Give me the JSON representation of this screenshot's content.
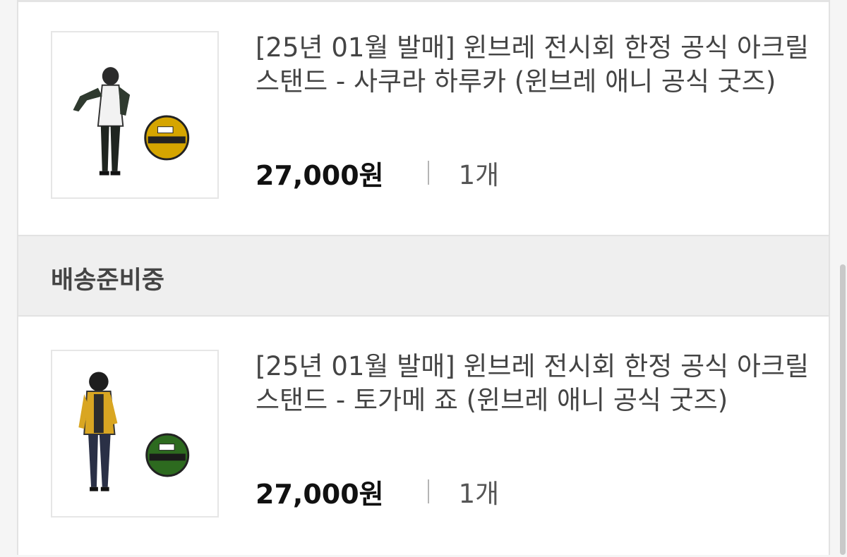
{
  "items": [
    {
      "title": "[25년 01월 발매] 윈브레 전시회 한정 공식 아크릴 스탠드 - 사쿠라 하루카 (윈브레 애니 공식 굿즈)",
      "price": "27,000원",
      "quantity": "1개",
      "badge_color": "#d5a500"
    },
    {
      "title": "[25년 01월 발매] 윈브레 전시회 한정 공식 아크릴 스탠드 - 토가메 죠 (윈브레 애니 공식 굿즈)",
      "price": "27,000원",
      "quantity": "1개",
      "badge_color": "#2d6a1f"
    }
  ],
  "status": {
    "label": "배송준비중"
  }
}
